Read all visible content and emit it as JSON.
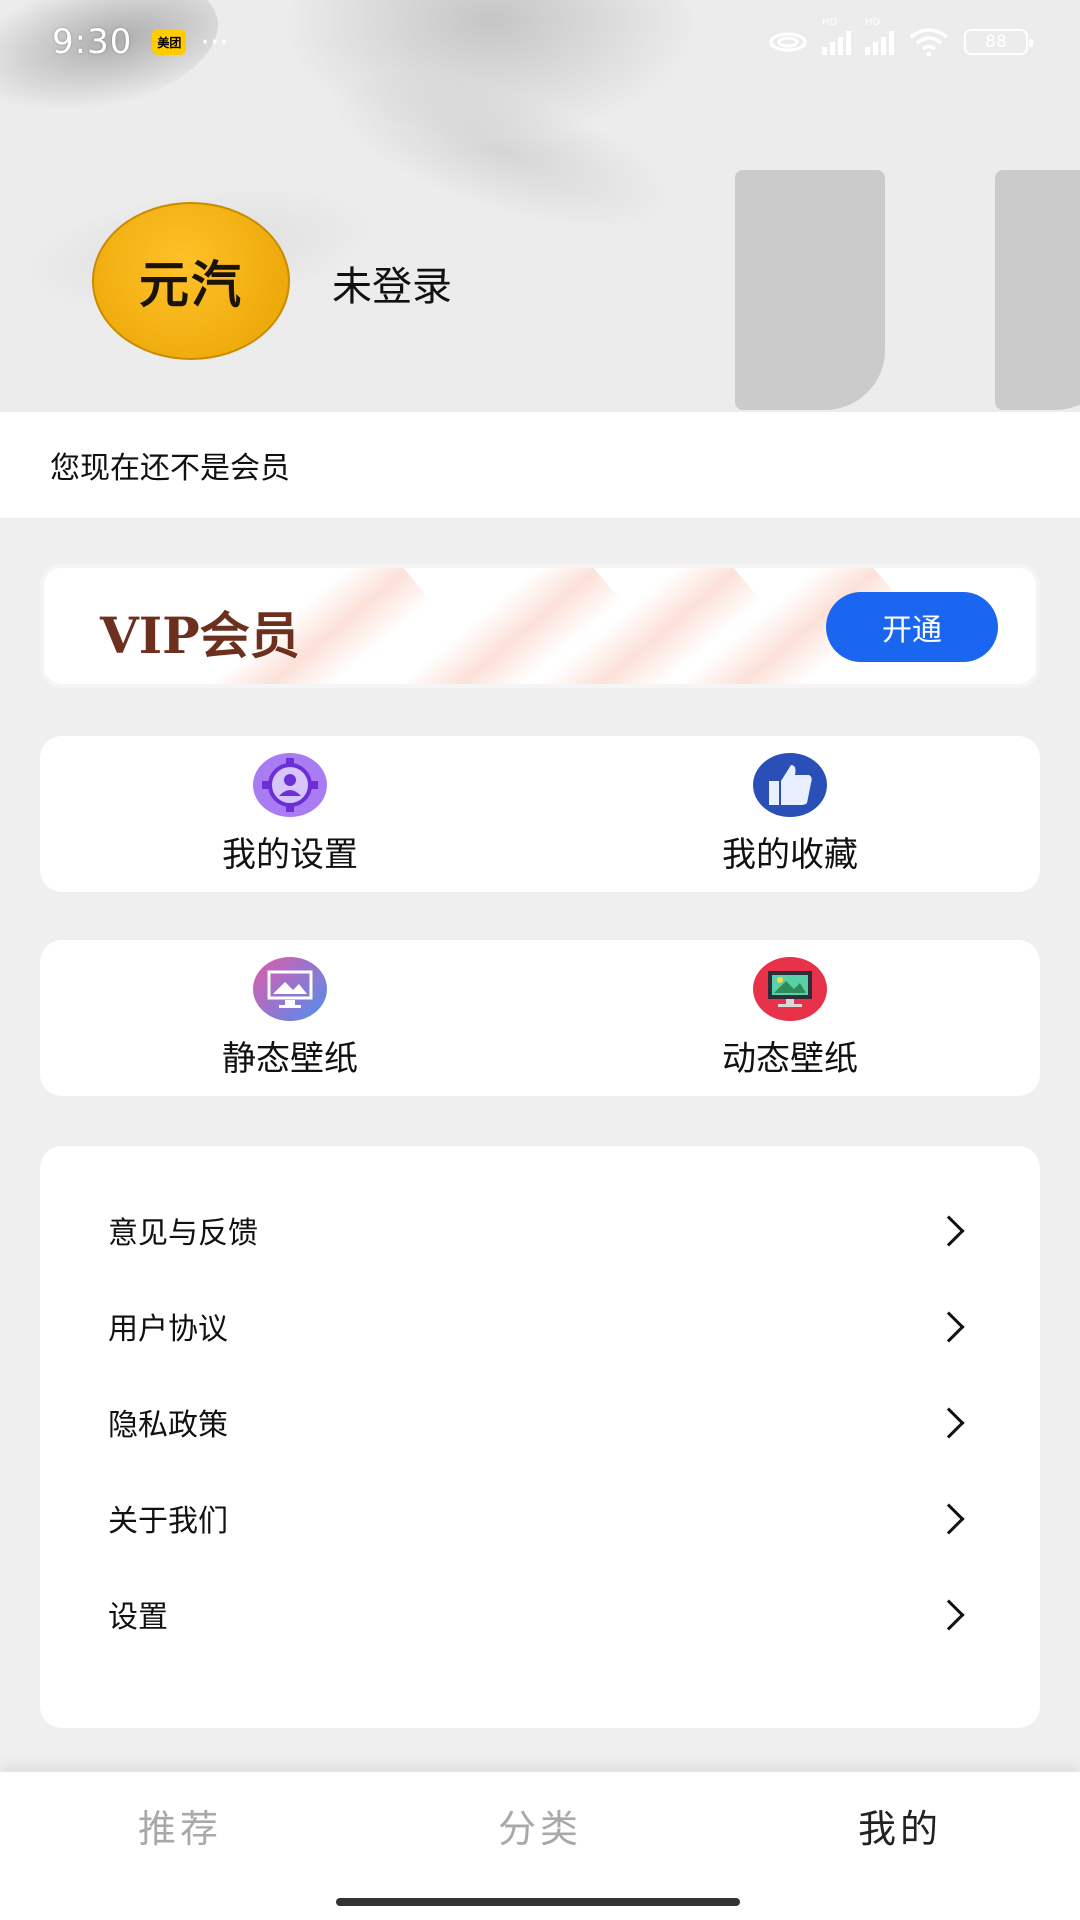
{
  "status_bar": {
    "time": "9:30",
    "badge": "美团",
    "more": "···",
    "battery": "88"
  },
  "profile": {
    "avatar_text": "元汽",
    "username": "未登录"
  },
  "member_status": "您现在还不是会员",
  "vip": {
    "title": "VIP会员",
    "button": "开通"
  },
  "grid": [
    {
      "label": "我的设置",
      "icon": "gear-user-icon",
      "color": "#8b5cf6"
    },
    {
      "label": "我的收藏",
      "icon": "thumbs-up-icon",
      "color": "#2b4fb8"
    },
    {
      "label": "静态壁纸",
      "icon": "picture-monitor-icon",
      "color": "#c06ad0"
    },
    {
      "label": "动态壁纸",
      "icon": "video-monitor-icon",
      "color": "#e8324a"
    }
  ],
  "menu": [
    {
      "label": "意见与反馈"
    },
    {
      "label": "用户协议"
    },
    {
      "label": "隐私政策"
    },
    {
      "label": "关于我们"
    },
    {
      "label": "设置"
    }
  ],
  "nav": {
    "tabs": [
      {
        "label": "推荐",
        "active": false
      },
      {
        "label": "分类",
        "active": false
      },
      {
        "label": "我的",
        "active": true
      }
    ]
  }
}
